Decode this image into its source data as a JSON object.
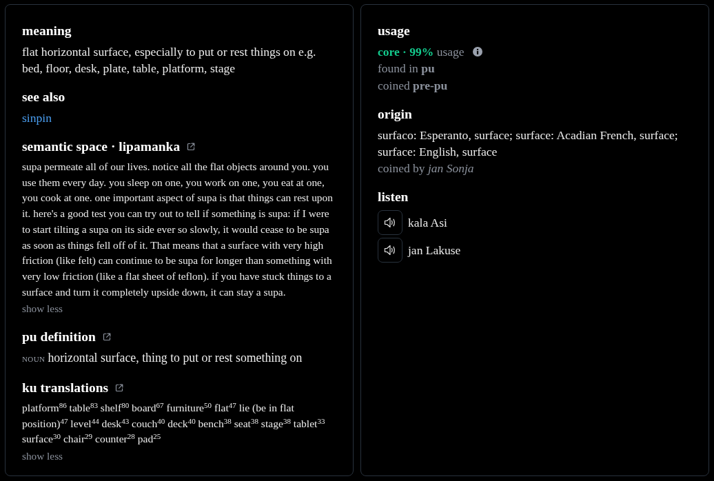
{
  "definition_card": {
    "meaning": {
      "heading": "meaning",
      "text": "flat horizontal surface, especially to put or rest things on e.g. bed, floor, desk, plate, table, platform, stage"
    },
    "see_also": {
      "heading": "see also",
      "links": [
        "sinpin"
      ]
    },
    "semantic_space": {
      "heading": "semantic space · lipamanka",
      "external_link": true,
      "text": "supa permeate all of our lives. notice all the flat objects around you. you use them every day. you sleep on one, you work on one, you eat at one, you cook at one. one important aspect of supa is that things can rest upon it. here's a good test you can try out to tell if something is supa: if I were to start tilting a supa on its side ever so slowly, it would cease to be supa as soon as things fell off of it. That means that a surface with very high friction (like felt) can continue to be supa for longer than something with very low friction (like a flat sheet of teflon). if you have stuck things to a surface and turn it completely upside down, it can stay a supa.",
      "toggle": "show less"
    },
    "pu_definition": {
      "heading": "pu definition",
      "external_link": true,
      "part_of_speech": "NOUN",
      "text": "horizontal surface, thing to put or rest something on"
    },
    "ku_translations": {
      "heading": "ku translations",
      "external_link": true,
      "translations": [
        {
          "word": "platform",
          "score": "86"
        },
        {
          "word": "table",
          "score": "83"
        },
        {
          "word": "shelf",
          "score": "80"
        },
        {
          "word": "board",
          "score": "67"
        },
        {
          "word": "furniture",
          "score": "50"
        },
        {
          "word": "flat",
          "score": "47"
        },
        {
          "word": "lie (be in flat position)",
          "score": "47"
        },
        {
          "word": "level",
          "score": "44"
        },
        {
          "word": "desk",
          "score": "43"
        },
        {
          "word": "couch",
          "score": "40"
        },
        {
          "word": "deck",
          "score": "40"
        },
        {
          "word": "bench",
          "score": "38"
        },
        {
          "word": "seat",
          "score": "38"
        },
        {
          "word": "stage",
          "score": "38"
        },
        {
          "word": "tablet",
          "score": "33"
        },
        {
          "word": "surface",
          "score": "30"
        },
        {
          "word": "chair",
          "score": "29"
        },
        {
          "word": "counter",
          "score": "28"
        },
        {
          "word": "pad",
          "score": "25"
        }
      ],
      "toggle": "show less"
    }
  },
  "details_card": {
    "usage": {
      "heading": "usage",
      "rating": "core · 99%",
      "rating_label": "usage",
      "found_in": "found in **pu**",
      "coined": "coined **pre-pu**"
    },
    "origin": {
      "heading": "origin",
      "text": "surfaco: Esperanto, surface; surface: Acadian French, surface; surface: English, surface",
      "coined_by": "coined by *jan Sonja*"
    },
    "listen": {
      "heading": "listen",
      "recordings": [
        {
          "speaker": "kala Asi"
        },
        {
          "speaker": "jan Lakuse"
        }
      ]
    }
  }
}
